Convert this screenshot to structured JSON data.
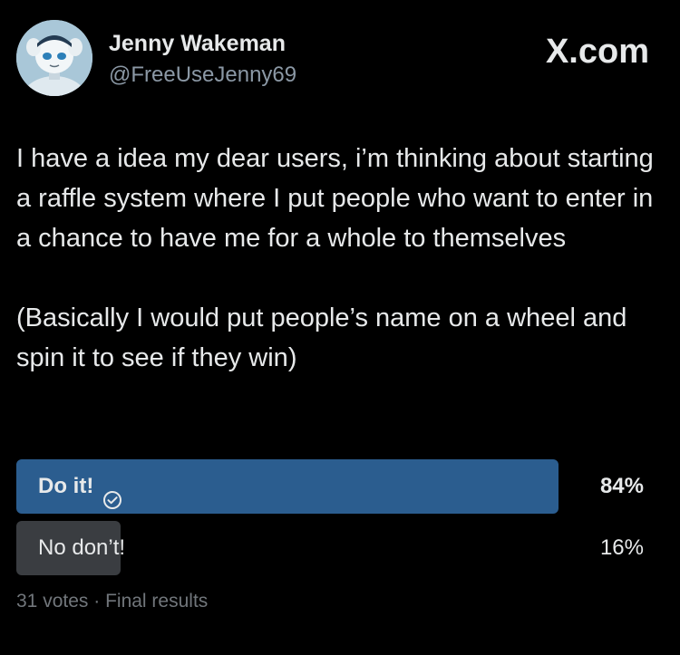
{
  "author": {
    "display_name": "Jenny Wakeman",
    "handle": "@FreeUseJenny69"
  },
  "brand": {
    "label": "X.com"
  },
  "tweet": {
    "paragraphs": [
      "I have a idea my dear users, i’m thinking about starting a raffle system where I put people who want to enter in a chance to have me for a whole to themselves",
      "(Basically I would put people’s name on a wheel and spin it to see if they win)"
    ]
  },
  "poll": {
    "options": [
      {
        "label": "Do it!",
        "percent_label": "84%",
        "percent": 84,
        "winner": true,
        "icon": "check-circle-icon"
      },
      {
        "label": "No don’t!",
        "percent_label": "16%",
        "percent": 16,
        "winner": false
      }
    ],
    "votes": "31 votes",
    "separator": "·",
    "status": "Final results"
  },
  "colors": {
    "background": "#000000",
    "text": "#e7e9ea",
    "secondary_text": "#8b98a5",
    "winner_bar": "#2b5d8f",
    "loser_bar": "#3a3d41"
  }
}
